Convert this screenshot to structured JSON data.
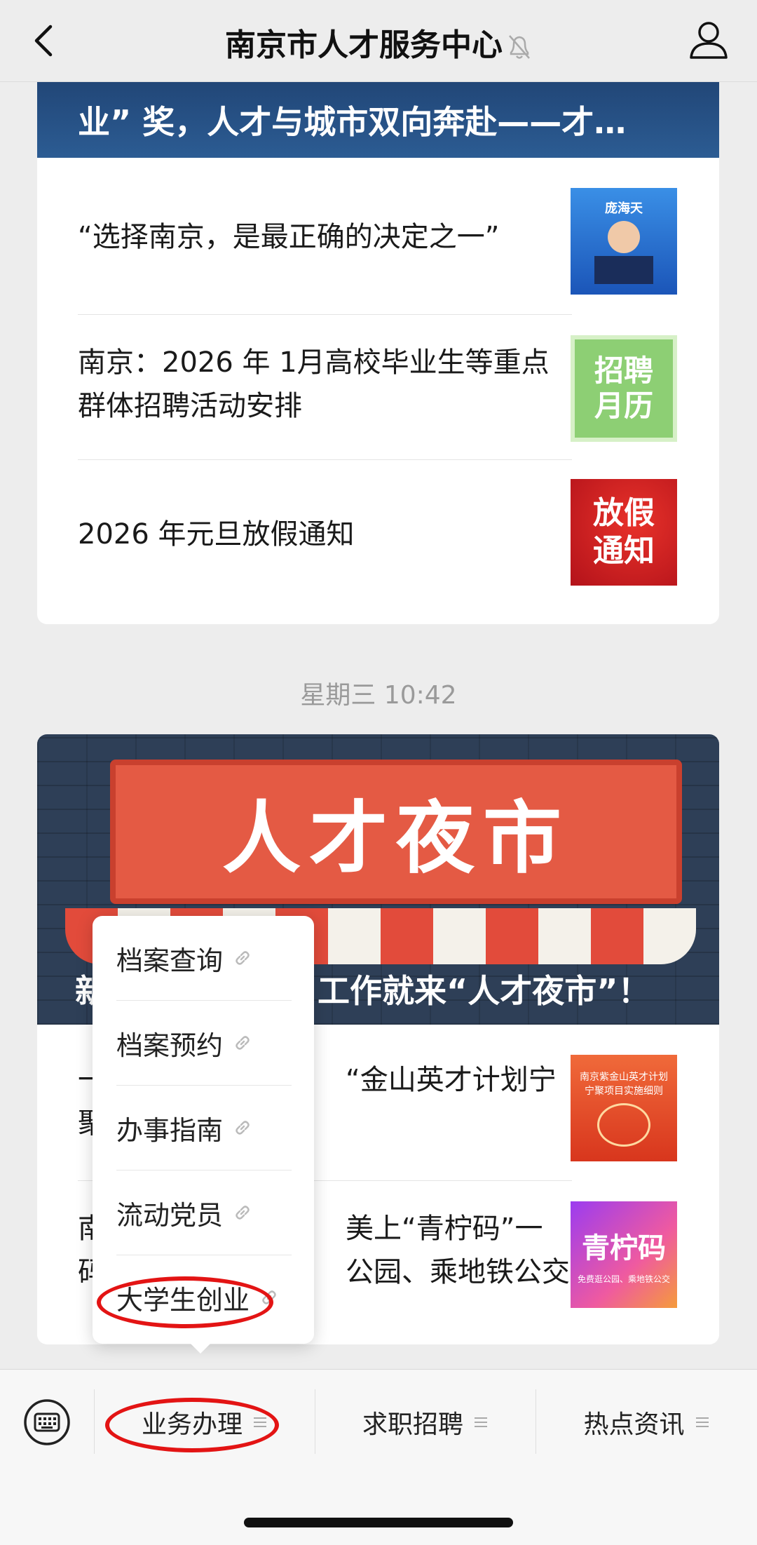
{
  "header": {
    "title": "南京市人才服务中心",
    "mute_icon": "bell-mute-icon",
    "back_icon": "chevron-left-icon",
    "profile_icon": "person-icon"
  },
  "feed": {
    "card1": {
      "banner_title": "业” 奖，人才与城市双向奔赴——才…",
      "articles": [
        {
          "title": "“选择南京，是最正确的决定之一”",
          "thumb_text": [
            "庞海天"
          ]
        },
        {
          "title": "南京：2026 年 1月高校毕业生等重点群体招聘活动安排",
          "thumb_text": [
            "招聘",
            "月历"
          ]
        },
        {
          "title": "2026 年元旦放假通知",
          "thumb_text": [
            "放假",
            "通知"
          ]
        }
      ]
    },
    "timestamp": "星期三 10:42",
    "card2": {
      "banner_sign": "人才夜市",
      "banner_title_left": "新",
      "banner_title_right": "工作就来“人才夜市”！",
      "articles": [
        {
          "title_left": "一",
          "title_right": "“金山英才计划宁",
          "title_left2": "聚",
          "thumb_text": [
            "南京紫金山英才计划",
            "宁聚项目实施细则"
          ]
        },
        {
          "title_left": "南",
          "title_right": "美上“青柠码”一",
          "title_left2": "码",
          "title_right2": "公园、乘地铁公交",
          "thumb_text": [
            "青柠码",
            "免费逛公园、乘地铁公交"
          ]
        }
      ]
    }
  },
  "popup_menu": {
    "items": [
      "档案查询",
      "档案预约",
      "办事指南",
      "流动党员",
      "大学生创业"
    ],
    "item_icon": "link-icon"
  },
  "bottom_menu": {
    "keyboard_icon": "keyboard-icon",
    "tabs": [
      {
        "label": "业务办理",
        "icon": "menu-lines-icon"
      },
      {
        "label": "求职招聘",
        "icon": "menu-lines-icon"
      },
      {
        "label": "热点资讯",
        "icon": "menu-lines-icon"
      }
    ]
  },
  "annotations": {
    "color": "#e31414"
  }
}
